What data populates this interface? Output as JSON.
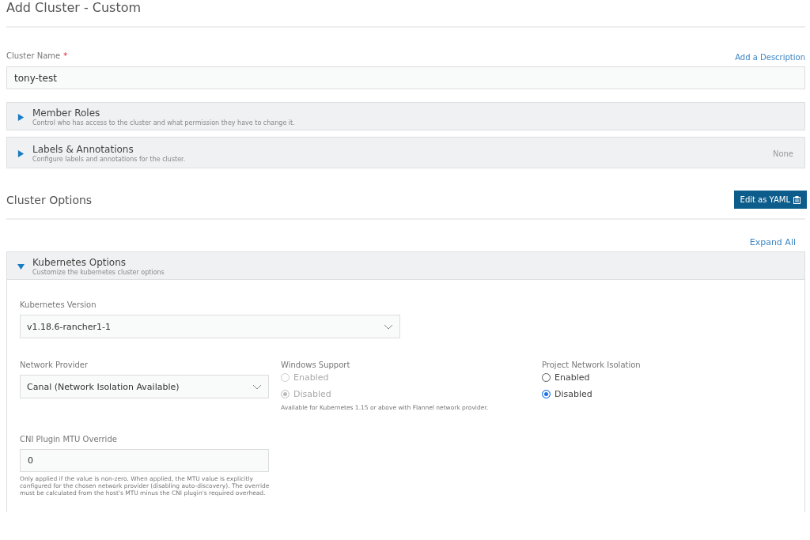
{
  "page_title": "Add Cluster - Custom",
  "cluster_name": {
    "label": "Cluster Name",
    "required_mark": "*",
    "value": "tony-test",
    "link": "Add a Description"
  },
  "sections": [
    {
      "title": "Member Roles",
      "subtitle": "Control who has access to the cluster and what permission they have to change it.",
      "expanded": false
    },
    {
      "title": "Labels & Annotations",
      "subtitle": "Configure labels and annotations for the cluster.",
      "expanded": false,
      "status": "None"
    }
  ],
  "cluster_options": {
    "title": "Cluster Options",
    "button": "Edit as YAML",
    "expand_all": "Expand All"
  },
  "kubernetes_options": {
    "title": "Kubernetes Options",
    "subtitle": "Customize the kubernetes cluster options",
    "expanded": true,
    "version": {
      "label": "Kubernetes Version",
      "value": "v1.18.6-rancher1-1"
    },
    "network_provider": {
      "label": "Network Provider",
      "value": "Canal (Network Isolation Available)"
    },
    "windows_support": {
      "label": "Windows Support",
      "disabled": true,
      "options": [
        {
          "label": "Enabled",
          "selected": false
        },
        {
          "label": "Disabled",
          "selected": true
        }
      ],
      "help": "Available for Kubernetes 1.15 or above with Flannel network provider."
    },
    "project_network_isolation": {
      "label": "Project Network Isolation",
      "disabled": false,
      "options": [
        {
          "label": "Enabled",
          "selected": false
        },
        {
          "label": "Disabled",
          "selected": true
        }
      ]
    },
    "mtu": {
      "label": "CNI Plugin MTU Override",
      "value": "0",
      "help": "Only applied if the value is non-zero. When applied, the MTU value is explicitly configured for the chosen network provider (disabling auto-discovery). The override must be calculated from the host's MTU minus the CNI plugin's required overhead."
    }
  }
}
